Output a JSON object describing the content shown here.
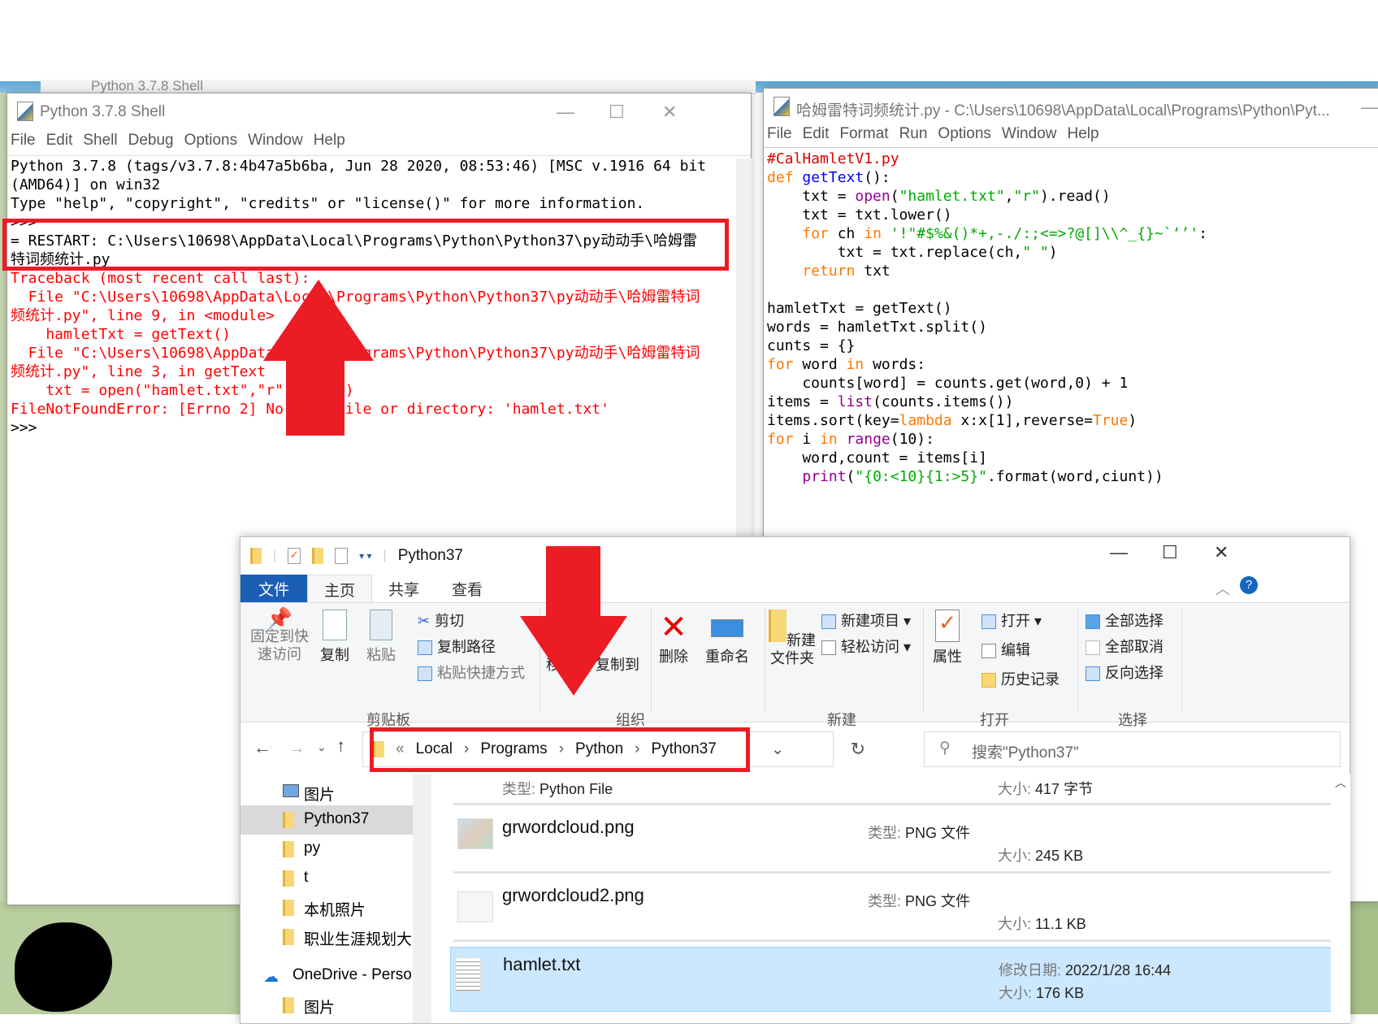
{
  "background_window": {
    "title": "Python 3.7.8 Shell"
  },
  "shell": {
    "title": "Python 3.7.8 Shell",
    "menu": [
      "File",
      "Edit",
      "Shell",
      "Debug",
      "Options",
      "Window",
      "Help"
    ],
    "lines": [
      [
        [
          "Python 3.7.8 (tags/v3.7.8:4b47a5b6ba, Jun 28 2020, 08:53:46) [MSC v.1916 64 bit",
          "pl"
        ]
      ],
      [
        [
          "(AMD64)] on win32",
          "pl"
        ]
      ],
      [
        [
          "Type \"help\", \"copyright\", \"credits\" or \"license()\" for more information.",
          "pl"
        ]
      ],
      [
        [
          ">>> ",
          "pl"
        ]
      ],
      [
        [
          "= RESTART: C:\\Users\\10698\\AppData\\Local\\Programs\\Python\\Python37\\py动动手\\哈姆雷",
          "pl"
        ]
      ],
      [
        [
          "特词频统计.py",
          "pl"
        ]
      ],
      [
        [
          "Traceback (most recent call last):",
          "er"
        ]
      ],
      [
        [
          "  File \"C:\\Users\\10698\\AppData\\Local\\Programs\\Python\\Python37\\py动动手\\哈姆雷特词",
          "er"
        ]
      ],
      [
        [
          "频统计.py\", line 9, in <module>",
          "er"
        ]
      ],
      [
        [
          "    hamletTxt = getText()",
          "er"
        ]
      ],
      [
        [
          "  File \"C:\\Users\\10698\\AppData\\Local\\Programs\\Python\\Python37\\py动动手\\哈姆雷特词",
          "er"
        ]
      ],
      [
        [
          "频统计.py\", line 3, in getText",
          "er"
        ]
      ],
      [
        [
          "    txt = open(\"hamlet.txt\",\"r\").read()",
          "er"
        ]
      ],
      [
        [
          "FileNotFoundError: [Errno 2] No such file or directory: 'hamlet.txt'",
          "er"
        ]
      ],
      [
        [
          ">>> ",
          "pl"
        ]
      ]
    ]
  },
  "editor": {
    "title": "哈姆雷特词频统计.py - C:\\Users\\10698\\AppData\\Local\\Programs\\Python\\Pyt...",
    "menu": [
      "File",
      "Edit",
      "Format",
      "Run",
      "Options",
      "Window",
      "Help"
    ],
    "lines": [
      [
        [
          "#CalHamletV1.py",
          "cm"
        ]
      ],
      [
        [
          "def ",
          "kw"
        ],
        [
          "getText",
          "df"
        ],
        [
          "():",
          "pl"
        ]
      ],
      [
        [
          "    txt = ",
          "pl"
        ],
        [
          "open",
          "bi"
        ],
        [
          "(",
          "pl"
        ],
        [
          "\"hamlet.txt\"",
          "st"
        ],
        [
          ",",
          "pl"
        ],
        [
          "\"r\"",
          "st"
        ],
        [
          ").read()",
          "pl"
        ]
      ],
      [
        [
          "    txt = txt.lower()",
          "pl"
        ]
      ],
      [
        [
          "    ",
          "pl"
        ],
        [
          "for",
          "kw"
        ],
        [
          " ch ",
          "pl"
        ],
        [
          "in",
          "kw"
        ],
        [
          " ",
          "pl"
        ],
        [
          "'!\"#$%&()*+,-./:;<=>?@[]\\\\^_{}~`‘’'",
          "st"
        ],
        [
          ":",
          "pl"
        ]
      ],
      [
        [
          "        txt = txt.replace(ch,",
          "pl"
        ],
        [
          "\" \"",
          "st"
        ],
        [
          ")",
          "pl"
        ]
      ],
      [
        [
          "    ",
          "pl"
        ],
        [
          "return",
          "kw"
        ],
        [
          " txt",
          "pl"
        ]
      ],
      [
        [
          "",
          "pl"
        ]
      ],
      [
        [
          "hamletTxt = getText()",
          "pl"
        ]
      ],
      [
        [
          "words = hamletTxt.split()",
          "pl"
        ]
      ],
      [
        [
          "cunts = {}",
          "pl"
        ]
      ],
      [
        [
          "for",
          "kw"
        ],
        [
          " word ",
          "pl"
        ],
        [
          "in",
          "kw"
        ],
        [
          " words:",
          "pl"
        ]
      ],
      [
        [
          "    counts[word] = counts.get(word,0) + 1",
          "pl"
        ]
      ],
      [
        [
          "items = ",
          "pl"
        ],
        [
          "list",
          "bi"
        ],
        [
          "(counts.items())",
          "pl"
        ]
      ],
      [
        [
          "items.sort(key=",
          "pl"
        ],
        [
          "lambda",
          "kw"
        ],
        [
          " x:x[1],reverse=",
          "pl"
        ],
        [
          "True",
          "kw"
        ],
        [
          ")",
          "pl"
        ]
      ],
      [
        [
          "for",
          "kw"
        ],
        [
          " i ",
          "pl"
        ],
        [
          "in",
          "kw"
        ],
        [
          " ",
          "pl"
        ],
        [
          "range",
          "bi"
        ],
        [
          "(10):",
          "pl"
        ]
      ],
      [
        [
          "    word,count = items[i]",
          "pl"
        ]
      ],
      [
        [
          "    ",
          "pl"
        ],
        [
          "print",
          "bi"
        ],
        [
          "(",
          "pl"
        ],
        [
          "\"{0:<10}{1:>5}\"",
          "st"
        ],
        [
          ".format(word,ciunt))",
          "pl"
        ]
      ]
    ]
  },
  "explorer": {
    "title": "Python37",
    "tabs": [
      "文件",
      "主页",
      "共享",
      "查看"
    ],
    "ribbon": {
      "pin": "固定到快\n速访问",
      "copy": "复制",
      "paste": "粘贴",
      "cut": "剪切",
      "copy_path": "复制路径",
      "paste_shortcut": "粘贴快捷方式",
      "move_to": "移动到",
      "copy_to": "复制到",
      "delete": "删除",
      "rename": "重命名",
      "new_folder": "新建\n文件夹",
      "new_item": "新建项目",
      "easy_access": "轻松访问",
      "properties": "属性",
      "open": "打开",
      "edit": "编辑",
      "history": "历史记录",
      "select_all": "全部选择",
      "select_none": "全部取消",
      "invert": "反向选择",
      "groups": [
        "剪贴板",
        "组织",
        "新建",
        "打开",
        "选择"
      ]
    },
    "address": [
      "«",
      "Local",
      "›",
      "Programs",
      "›",
      "Python",
      "›",
      "Python37"
    ],
    "search_placeholder": "搜索\"Python37\"",
    "nav": [
      "图片",
      "Python37",
      "py",
      "t",
      "本机照片",
      "职业生涯规划大赛",
      "OneDrive - Personal",
      "图片"
    ],
    "files": [
      {
        "name": "",
        "type_label": "类型:",
        "type": "Python File",
        "size_label": "大小:",
        "size": "417 字节"
      },
      {
        "name": "grwordcloud.png",
        "type_label": "类型:",
        "type": "PNG 文件",
        "size_label": "大小:",
        "size": "245 KB"
      },
      {
        "name": "grwordcloud2.png",
        "type_label": "类型:",
        "type": "PNG 文件",
        "size_label": "大小:",
        "size": "11.1 KB"
      },
      {
        "name": "hamlet.txt",
        "date_label": "修改日期:",
        "date": "2022/1/28 16:44",
        "size_label": "大小:",
        "size": "176 KB"
      }
    ]
  },
  "colors": {
    "annotation_red": "#ec1c24",
    "selection": "#cce8ff",
    "file_tab": "#1a5fb4"
  }
}
